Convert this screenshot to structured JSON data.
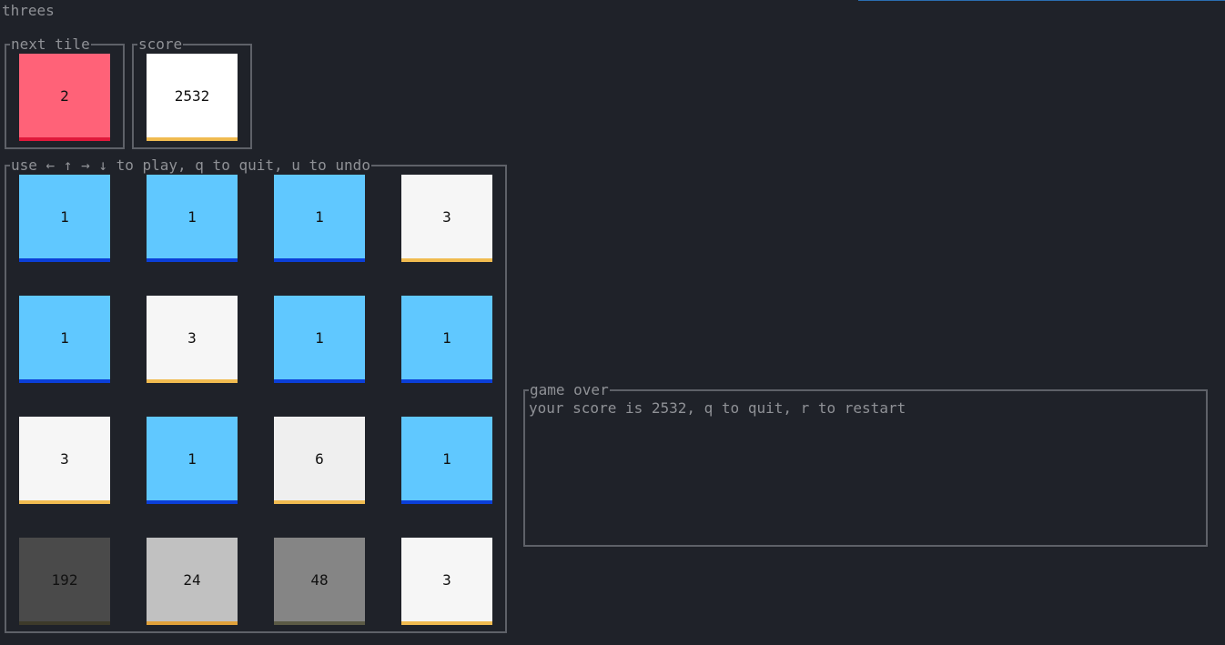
{
  "app": {
    "title": "threes"
  },
  "next_tile": {
    "legend": "next tile",
    "value": "2",
    "kind": "t-2"
  },
  "score": {
    "legend": "score",
    "value": "2532"
  },
  "board": {
    "legend": "use ← ↑ → ↓ to play, q to quit, u to undo",
    "rows": [
      [
        "1",
        "1",
        "1",
        "3"
      ],
      [
        "1",
        "3",
        "1",
        "1"
      ],
      [
        "3",
        "1",
        "6",
        "1"
      ],
      [
        "192",
        "24",
        "48",
        "3"
      ]
    ]
  },
  "game_over": {
    "legend": "game over",
    "message": "your score is 2532, q to quit, r to restart"
  },
  "colors": {
    "background": "#1f2229",
    "border": "#5e6168",
    "tile_1": "#60c8ff",
    "tile_2": "#ff6278",
    "tile_3": "#f6f6f6"
  }
}
